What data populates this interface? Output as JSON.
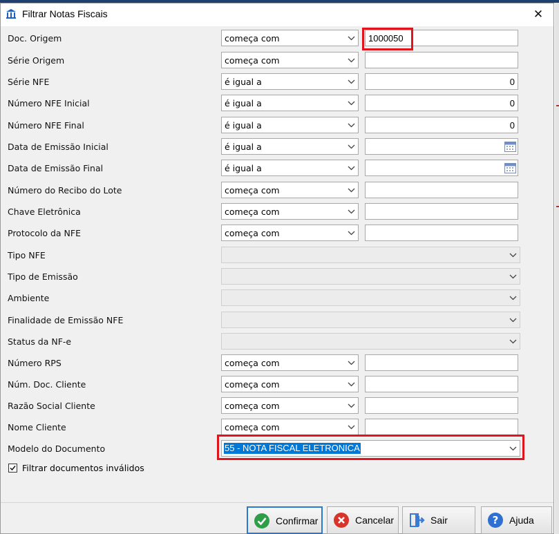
{
  "window": {
    "title": "Filtrar Notas Fiscais",
    "close_glyph": "✕"
  },
  "rows": [
    {
      "label": "Doc. Origem",
      "kind": "text",
      "operator": "começa com",
      "value": "1000050"
    },
    {
      "label": "Série Origem",
      "kind": "text",
      "operator": "começa com",
      "value": ""
    },
    {
      "label": "Série NFE",
      "kind": "number",
      "operator": "é igual a",
      "value": "0"
    },
    {
      "label": "Número NFE Inicial",
      "kind": "number",
      "operator": "é igual a",
      "value": "0"
    },
    {
      "label": "Número NFE Final",
      "kind": "number",
      "operator": "é igual a",
      "value": "0"
    },
    {
      "label": "Data de Emissão Inicial",
      "kind": "date",
      "operator": "é igual a",
      "value": ""
    },
    {
      "label": "Data de Emissão Final",
      "kind": "date",
      "operator": "é igual a",
      "value": ""
    },
    {
      "label": "Número do Recibo do Lote",
      "kind": "text",
      "operator": "começa com",
      "value": ""
    },
    {
      "label": "Chave Eletrônica",
      "kind": "text",
      "operator": "começa com",
      "value": ""
    },
    {
      "label": "Protocolo da NFE",
      "kind": "text",
      "operator": "começa com",
      "value": ""
    },
    {
      "label": "Tipo NFE",
      "kind": "select-disabled",
      "value": ""
    },
    {
      "label": "Tipo de Emissão",
      "kind": "select-disabled",
      "value": ""
    },
    {
      "label": "Ambiente",
      "kind": "select-disabled",
      "value": ""
    },
    {
      "label": "Finalidade de Emissão NFE",
      "kind": "select-disabled",
      "value": ""
    },
    {
      "label": "Status da NF-e",
      "kind": "select-disabled",
      "value": ""
    },
    {
      "label": "Número RPS",
      "kind": "text",
      "operator": "começa com",
      "value": ""
    },
    {
      "label": "Núm. Doc. Cliente",
      "kind": "text",
      "operator": "começa com",
      "value": ""
    },
    {
      "label": "Razão Social Cliente",
      "kind": "text",
      "operator": "começa com",
      "value": ""
    },
    {
      "label": "Nome Cliente",
      "kind": "text",
      "operator": "começa com",
      "value": ""
    },
    {
      "label": "Modelo do Documento",
      "kind": "select",
      "value": "55 - NOTA FISCAL ELETRONICA"
    }
  ],
  "invalid_filter": {
    "label": "Filtrar documentos inválidos",
    "checked": true
  },
  "buttons": [
    {
      "label": "Confirmar",
      "icon": "check-circle-icon",
      "color": "#2e9e48"
    },
    {
      "label": "Cancelar",
      "icon": "cancel-circle-icon",
      "color": "#d9342b"
    },
    {
      "label": "Sair",
      "icon": "exit-door-icon",
      "color": "#3a7bd5"
    },
    {
      "label": "Ajuda",
      "icon": "help-circle-icon",
      "color": "#2f6fd0"
    }
  ],
  "colors": {
    "highlight_border": "#e0141c",
    "selection": "#0078d7",
    "focus_border": "#2a78d2"
  }
}
